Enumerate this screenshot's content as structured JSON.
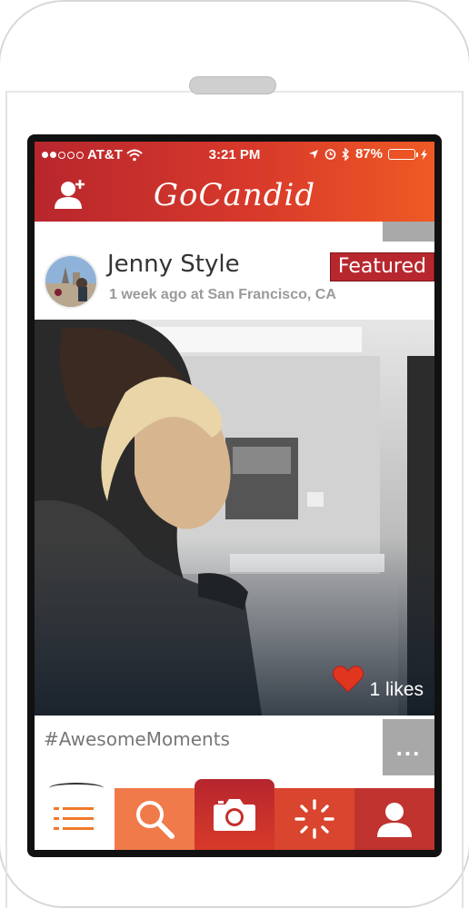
{
  "status_bar": {
    "carrier": "AT&T",
    "time": "3:21 PM",
    "battery": "87%",
    "battery_level": 0.87
  },
  "nav": {
    "title": "GoCandid",
    "left_icon": "add-friend-icon"
  },
  "post": {
    "username": "Jenny Style",
    "timestamp_location": "1 week ago at San Francisco, CA",
    "badge": "Featured",
    "likes": "1 likes",
    "caption": "#AwesomeMoments",
    "more_label": "..."
  },
  "tabs": [
    {
      "name": "feed",
      "icon": "list-icon"
    },
    {
      "name": "search",
      "icon": "search-icon"
    },
    {
      "name": "camera",
      "icon": "camera-icon"
    },
    {
      "name": "activity",
      "icon": "activity-icon"
    },
    {
      "name": "profile",
      "icon": "profile-icon"
    }
  ],
  "colors": {
    "brand_red": "#b8262d",
    "brand_orange": "#ef5a24",
    "gray_tab": "#a9a9a9",
    "battery_green": "#4cd964"
  }
}
